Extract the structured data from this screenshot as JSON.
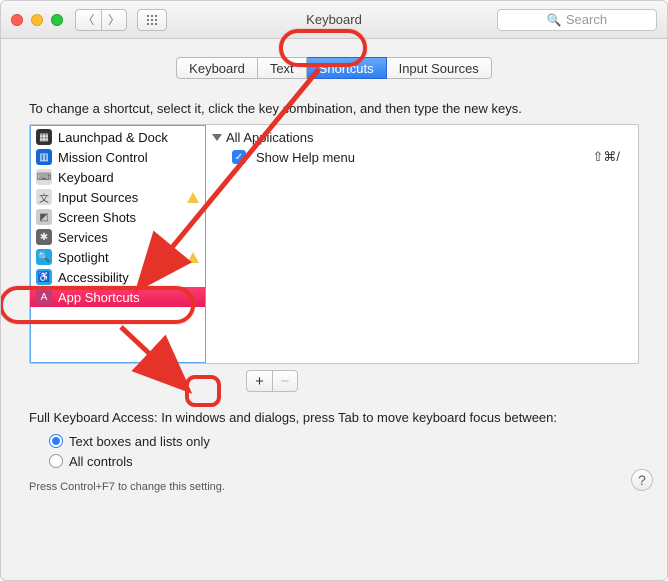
{
  "window": {
    "title": "Keyboard"
  },
  "search": {
    "placeholder": "Search"
  },
  "tabs": [
    {
      "label": "Keyboard"
    },
    {
      "label": "Text"
    },
    {
      "label": "Shortcuts",
      "active": true
    },
    {
      "label": "Input Sources"
    }
  ],
  "instruction": "To change a shortcut, select it, click the key combination, and then type the new keys.",
  "categories": [
    {
      "label": "Launchpad & Dock",
      "icon": "launchpad-icon",
      "icon_bg": "#333",
      "icon_fg": "#fff"
    },
    {
      "label": "Mission Control",
      "icon": "mission-control-icon",
      "icon_bg": "#1668d6",
      "icon_fg": "#fff"
    },
    {
      "label": "Keyboard",
      "icon": "keyboard-icon",
      "icon_bg": "#ddd",
      "icon_fg": "#555"
    },
    {
      "label": "Input Sources",
      "icon": "input-sources-icon",
      "icon_bg": "#ddd",
      "icon_fg": "#555",
      "warn": true
    },
    {
      "label": "Screen Shots",
      "icon": "screenshot-icon",
      "icon_bg": "#ccc",
      "icon_fg": "#555"
    },
    {
      "label": "Services",
      "icon": "services-icon",
      "icon_bg": "#666",
      "icon_fg": "#eee"
    },
    {
      "label": "Spotlight",
      "icon": "spotlight-icon",
      "icon_bg": "#1fa9e7",
      "icon_fg": "#fff",
      "warn": true
    },
    {
      "label": "Accessibility",
      "icon": "accessibility-icon",
      "icon_bg": "#1fa9e7",
      "icon_fg": "#fff"
    },
    {
      "label": "App Shortcuts",
      "icon": "app-shortcuts-icon",
      "icon_bg": "#c03a76",
      "icon_fg": "#fff",
      "selected": true
    }
  ],
  "detail": {
    "group": "All Applications",
    "items": [
      {
        "label": "Show Help menu",
        "checked": true,
        "shortcut": "⇧⌘/"
      }
    ]
  },
  "buttons": {
    "add": "+",
    "remove": "−"
  },
  "fullkb": {
    "label": "Full Keyboard Access: In windows and dialogs, press Tab to move keyboard focus between:",
    "opt1": "Text boxes and lists only",
    "opt2": "All controls",
    "note": "Press Control+F7 to change this setting."
  }
}
